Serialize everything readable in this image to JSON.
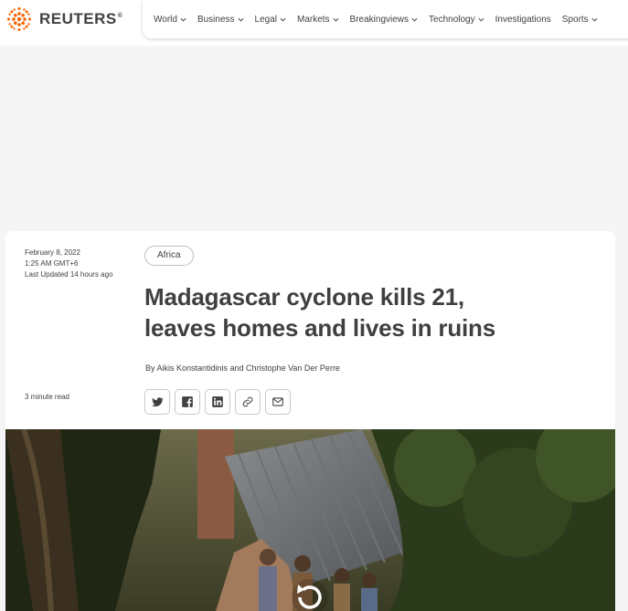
{
  "header": {
    "logo_text": "REUTERS",
    "logo_mark": "®",
    "nav": [
      {
        "label": "World",
        "icon": "chevron-down-icon"
      },
      {
        "label": "Business",
        "icon": "chevron-down-icon"
      },
      {
        "label": "Legal",
        "icon": "chevron-down-icon"
      },
      {
        "label": "Markets",
        "icon": "chevron-down-icon"
      },
      {
        "label": "Breakingviews",
        "icon": "chevron-down-icon"
      },
      {
        "label": "Technology",
        "icon": "chevron-down-icon"
      },
      {
        "label": "Investigations"
      },
      {
        "label": "Sports",
        "icon": "chevron-down-icon"
      }
    ]
  },
  "article": {
    "date": "February 8, 2022",
    "time": "1:25 AM GMT+6",
    "updated": "Last Updated 14 hours ago",
    "read_time": "3 minute read",
    "tag": "Africa",
    "headline_line1": "Madagascar cyclone kills 21,",
    "headline_line2": "leaves homes and lives in ruins",
    "byline": "By Aikis Konstantidinis and Christophe Van Der Perre",
    "share": [
      "twitter-icon",
      "facebook-icon",
      "linkedin-icon",
      "link-icon",
      "email-icon"
    ]
  },
  "colors": {
    "brand_orange": "#fa6400",
    "text": "#404040",
    "background": "#f5f5f5"
  }
}
